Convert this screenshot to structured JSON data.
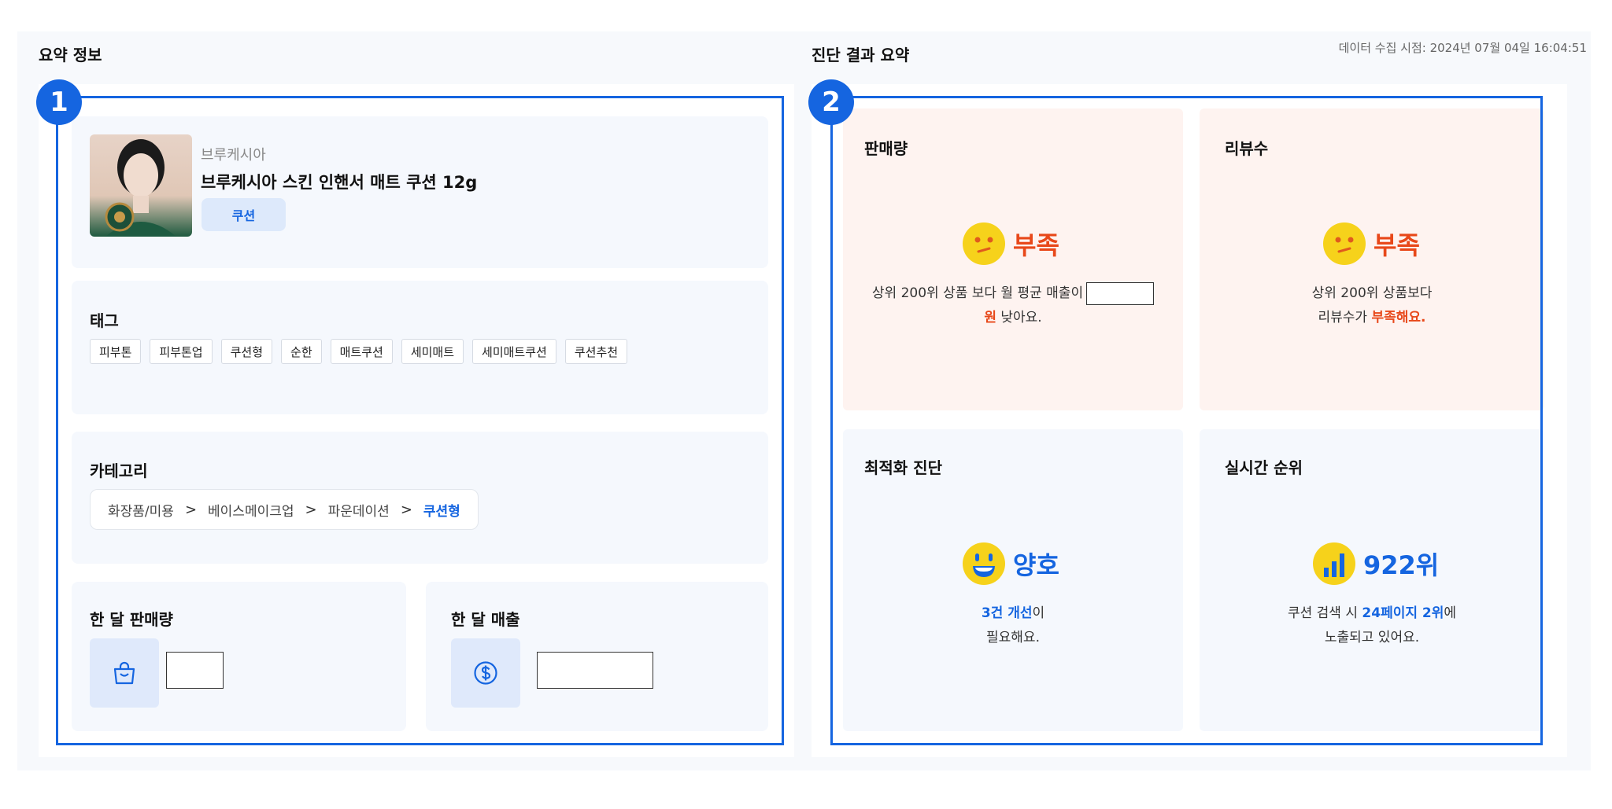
{
  "timestamp": "데이터 수집 시점: 2024년 07월 04일 16:04:51",
  "summary": {
    "title": "요약 정보",
    "badge": "1",
    "product": {
      "brand": "브루케시아",
      "name": "브루케시아 스킨 인핸서 매트 쿠션 12g",
      "type": "쿠션"
    },
    "tags_title": "태그",
    "tags": [
      "피부톤",
      "피부톤업",
      "쿠션형",
      "순한",
      "매트쿠션",
      "세미매트",
      "세미매트쿠션",
      "쿠션추천"
    ],
    "category_title": "카테고리",
    "category": [
      "화장품/미용",
      "베이스메이크업",
      "파운데이션",
      "쿠션형"
    ],
    "category_sep": ">",
    "monthly_sales_title": "한 달 판매량",
    "monthly_revenue_title": "한 달 매출"
  },
  "diagnosis": {
    "title": "진단 결과 요약",
    "badge": "2",
    "sales": {
      "title": "판매량",
      "status": "부족",
      "desc_pre": "상위 200위 상품 보다 월 평균 매출이",
      "desc_unit": "원",
      "desc_post": " 낮아요."
    },
    "reviews": {
      "title": "리뷰수",
      "status": "부족",
      "line1": "상위 200위 상품보다",
      "line2_pre": "리뷰수가 ",
      "line2_em": "부족해요."
    },
    "optimization": {
      "title": "최적화 진단",
      "status": "양호",
      "line1_em": "3건 개선",
      "line1_post": "이",
      "line2": "필요해요."
    },
    "ranking": {
      "title": "실시간 순위",
      "status": "922위",
      "line1_pre": "쿠션 검색 시 ",
      "line1_em": "24페이지 2위",
      "line1_post": "에",
      "line2": "노출되고 있어요."
    }
  },
  "colors": {
    "accent": "#1565e0",
    "warn": "#e8481a",
    "emoji": "#f6d21b",
    "warn_bg": "#fef3f0"
  }
}
